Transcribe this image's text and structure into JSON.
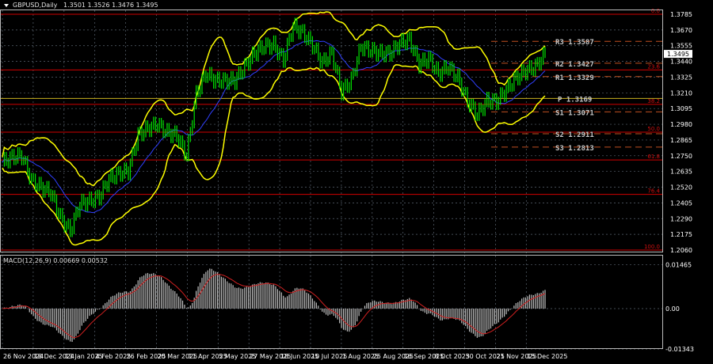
{
  "header": {
    "symbol": "GBPUSD,Daily",
    "ohlc": "1.3501 1.3526 1.3476 1.3495"
  },
  "macd_header": {
    "label": "MACD(12,26,9) 0.00669 0.00532"
  },
  "colors": {
    "bars": "#00e000",
    "bands": "#ffff00",
    "fib": "#d00000",
    "pivot": "#c05020",
    "grid": "#5a6470",
    "signal": "#d02020",
    "hist": "#c0c0c0"
  },
  "chart_data": {
    "type": "bar",
    "title": "GBPUSD,Daily",
    "price_ticks": [
      "1.3785",
      "1.3670",
      "1.3555",
      "1.3440",
      "1.3325",
      "1.3210",
      "1.3095",
      "1.2980",
      "1.2865",
      "1.2750",
      "1.2635",
      "1.2520",
      "1.2405",
      "1.2290",
      "1.2175",
      "1.2060"
    ],
    "price_range": [
      1.206,
      1.3785
    ],
    "current_price": "1.3495",
    "date_labels": [
      "26 Nov 2024",
      "18 Dec 2024",
      "13 Jan 2025",
      "4 Feb 2025",
      "26 Feb 2025",
      "20 Mar 2025",
      "11 Apr 2025",
      "5 May 2025",
      "27 May 2025",
      "18 Jun 2025",
      "10 Jul 2025",
      "1 Aug 2025",
      "25 Aug 2025",
      "16 Sep 2025",
      "8 Oct 2025",
      "30 Oct 2025",
      "21 Nov 2025",
      "15 Dec 2025"
    ],
    "weekly_closes": [
      1.27,
      1.274,
      1.275,
      1.257,
      1.252,
      1.248,
      1.23,
      1.22,
      1.24,
      1.242,
      1.245,
      1.258,
      1.262,
      1.264,
      1.29,
      1.295,
      1.298,
      1.292,
      1.29,
      1.275,
      1.32,
      1.335,
      1.33,
      1.33,
      1.33,
      1.34,
      1.35,
      1.355,
      1.356,
      1.345,
      1.37,
      1.365,
      1.356,
      1.343,
      1.35,
      1.322,
      1.33,
      1.355,
      1.352,
      1.35,
      1.35,
      1.357,
      1.36,
      1.342,
      1.346,
      1.335,
      1.34,
      1.332,
      1.315,
      1.305,
      1.315,
      1.315,
      1.323,
      1.332,
      1.337,
      1.34,
      1.3495
    ],
    "fibonacci": {
      "high": 1.3785,
      "low": 1.206,
      "levels": [
        {
          "ratio": 0.0,
          "label": "0.0"
        },
        {
          "ratio": 0.236,
          "label": "23.6"
        },
        {
          "ratio": 0.382,
          "label": "38.2"
        },
        {
          "ratio": 0.5,
          "label": "50.0"
        },
        {
          "ratio": 0.618,
          "label": "61.8"
        },
        {
          "ratio": 0.764,
          "label": "76.4"
        },
        {
          "ratio": 1.0,
          "label": "100.0"
        }
      ]
    },
    "pivots": [
      {
        "label": "R3 1.3587",
        "value": 1.3587
      },
      {
        "label": "R2 1.3427",
        "value": 1.3427
      },
      {
        "label": "R1 1.3329",
        "value": 1.3329
      },
      {
        "label": "P 1.3169",
        "value": 1.3169
      },
      {
        "label": "S1 1.3071",
        "value": 1.3071
      },
      {
        "label": "S2 1.2911",
        "value": 1.2911
      },
      {
        "label": "S3 1.2813",
        "value": 1.2813
      }
    ],
    "macd": {
      "params": "12,26,9",
      "value": 0.00669,
      "signal": 0.00532,
      "ticks": [
        "0.01465",
        "0.00",
        "-0.01343"
      ],
      "range": [
        -0.01343,
        0.01465
      ]
    }
  }
}
